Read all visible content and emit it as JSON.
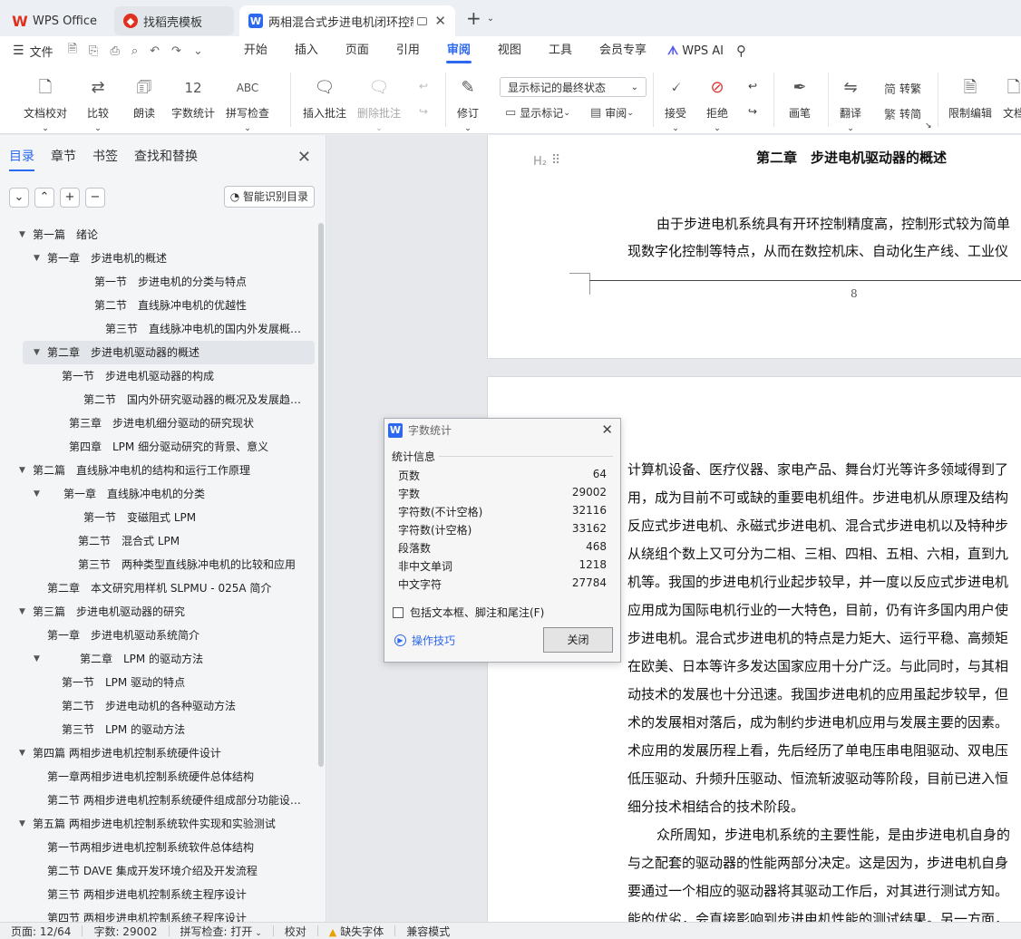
{
  "tabs": [
    {
      "label": "WPS Office",
      "icon": "wps-logo-icon"
    },
    {
      "label": "找稻壳模板",
      "icon": "docer-icon"
    },
    {
      "label": "两相混合式步进电机闭环控制系",
      "icon": "word-doc-icon"
    }
  ],
  "menu": {
    "file_label": "文件",
    "items": [
      "开始",
      "插入",
      "页面",
      "引用",
      "审阅",
      "视图",
      "工具",
      "会员专享"
    ],
    "active": "审阅",
    "ai_label": "WPS AI"
  },
  "ribbon": {
    "proofread": "文档校对",
    "compare": "比较",
    "read_aloud": "朗读",
    "word_count": "字数统计",
    "spell_check": "拼写检查",
    "insert_comment": "插入批注",
    "delete_comment": "删除批注",
    "revise": "修订",
    "markup_mode": "显示标记的最终状态",
    "show_markup": "显示标记",
    "review": "审阅",
    "accept": "接受",
    "reject": "拒绝",
    "pen": "画笔",
    "translate": "翻译",
    "to_traditional": "转繁",
    "to_simplified": "转简",
    "restrict_edit": "限制编辑",
    "document_more": "文档"
  },
  "sidebar": {
    "tabs": [
      "目录",
      "章节",
      "书签",
      "查找和替换"
    ],
    "active_tab": "目录",
    "smart_toc": "智能识别目录",
    "toc": [
      {
        "label": "第一篇　绪论",
        "arrow": true
      },
      {
        "label": "第一章　步进电机的概述",
        "arrow": true
      },
      {
        "label": "第一节　步进电机的分类与特点",
        "arrow": false
      },
      {
        "label": "第二节　直线脉冲电机的优越性",
        "arrow": false
      },
      {
        "label": "第三节　直线脉冲电机的国内外发展概…",
        "arrow": false
      },
      {
        "label": "第二章　步进电机驱动器的概述",
        "arrow": true
      },
      {
        "label": "第一节　步进电机驱动器的构成",
        "arrow": false
      },
      {
        "label": "第二节　国内外研究驱动器的概况及发展趋…",
        "arrow": false
      },
      {
        "label": "第三章　步进电机细分驱动的研究现状",
        "arrow": false
      },
      {
        "label": "第四章　LPM 细分驱动研究的背景、意义",
        "arrow": false
      },
      {
        "label": "第二篇　直线脉冲电机的结构和运行工作原理",
        "arrow": true
      },
      {
        "label": "第一章　直线脉冲电机的分类",
        "arrow": true
      },
      {
        "label": "第一节　变磁阻式 LPM",
        "arrow": false
      },
      {
        "label": "第二节　混合式 LPM",
        "arrow": false
      },
      {
        "label": "第三节　两种类型直线脉冲电机的比较和应用",
        "arrow": false
      },
      {
        "label": "第二章　本文研究用样机 SLPMU - 025A 简介",
        "arrow": false
      },
      {
        "label": "第三篇　步进电机驱动器的研究",
        "arrow": true
      },
      {
        "label": "第一章　步进电机驱动系统简介",
        "arrow": false
      },
      {
        "label": "第二章　LPM 的驱动方法",
        "arrow": true
      },
      {
        "label": "第一节　LPM 驱动的特点",
        "arrow": false
      },
      {
        "label": "第二节　步进电动机的各种驱动方法",
        "arrow": false
      },
      {
        "label": "第三节　LPM 的驱动方法",
        "arrow": false
      },
      {
        "label": "第四篇  两相步进电机控制系统硬件设计",
        "arrow": true
      },
      {
        "label": "第一章两相步进电机控制系统硬件总体结构",
        "arrow": false
      },
      {
        "label": "第二节  两相步进电机控制系统硬件组成部分功能设…",
        "arrow": false
      },
      {
        "label": "第五篇  两相步进电机控制系统软件实现和实验测试",
        "arrow": true
      },
      {
        "label": "第一节两相步进电机控制系统软件总体结构",
        "arrow": false
      },
      {
        "label": "第二节 DAVE 集成开发环境介绍及开发流程",
        "arrow": false
      },
      {
        "label": "第三节  两相步进电机控制系统主程序设计",
        "arrow": false
      },
      {
        "label": "第四节  两相步进电机控制系统子程序设计",
        "arrow": false
      }
    ]
  },
  "document": {
    "heading_marker": "H₂",
    "chapter_title": "第二章　步进电机驱动器的概述",
    "page1_lines": [
      "由于步进电机系统具有开环控制精度高，控制形式较为简单",
      "现数字化控制等特点，从而在数控机床、自动化生产线、工业仪"
    ],
    "page_number": "8",
    "page2_lines": [
      "计算机设备、医疗仪器、家电产品、舞台灯光等许多领域得到了",
      "用，成为目前不可或缺的重要电机组件。步进电机从原理及结构",
      "反应式步进电机、永磁式步进电机、混合式步进电机以及特种步",
      "从绕组个数上又可分为二相、三相、四相、五相、六相，直到九",
      "机等。我国的步进电机行业起步较早，并一度以反应式步进电机",
      "应用成为国际电机行业的一大特色，目前，仍有许多国内用户使",
      "步进电机。混合式步进电机的特点是力矩大、运行平稳、高频矩",
      "在欧美、日本等许多发达国家应用十分广泛。与此同时，与其相",
      "动技术的发展也十分迅速。我国步进电机的应用虽起步较早，但",
      "术的发展相对落后，成为制约步进电机应用与发展主要的因素。",
      "术应用的发展历程上看，先后经历了单电压串电阻驱动、双电压",
      "低压驱动、升频升压驱动、恒流斩波驱动等阶段，目前已进入恒",
      "细分技术相结合的技术阶段。",
      "众所周知，步进电机系统的主要性能，是由步进电机自身的",
      "与之配套的驱动器的性能两部分决定。这是因为，步进电机自身",
      "要通过一个相应的驱动器将其驱动工作后，对其进行测试方知。",
      "能的优劣，会直接影响到步进电机性能的测试结果。另一方面，"
    ]
  },
  "word_count_dialog": {
    "title": "字数统计",
    "section": "统计信息",
    "rows": [
      {
        "label": "页数",
        "value": "64"
      },
      {
        "label": "字数",
        "value": "29002"
      },
      {
        "label": "字符数(不计空格)",
        "value": "32116"
      },
      {
        "label": "字符数(计空格)",
        "value": "33162"
      },
      {
        "label": "段落数",
        "value": "468"
      },
      {
        "label": "非中文单词",
        "value": "1218"
      },
      {
        "label": "中文字符",
        "value": "27784"
      }
    ],
    "checkbox_label": "包括文本框、脚注和尾注(F)",
    "checkbox_checked": false,
    "tips_label": "操作技巧",
    "close_label": "关闭"
  },
  "statusbar": {
    "page": "页面: 12/64",
    "words": "字数: 29002",
    "spell": "拼写检查: 打开",
    "proof": "校对",
    "missing_fonts": "缺失字体",
    "compat": "兼容模式"
  },
  "colors": {
    "accent": "#2d68f0",
    "wps_red": "#e0301e"
  }
}
